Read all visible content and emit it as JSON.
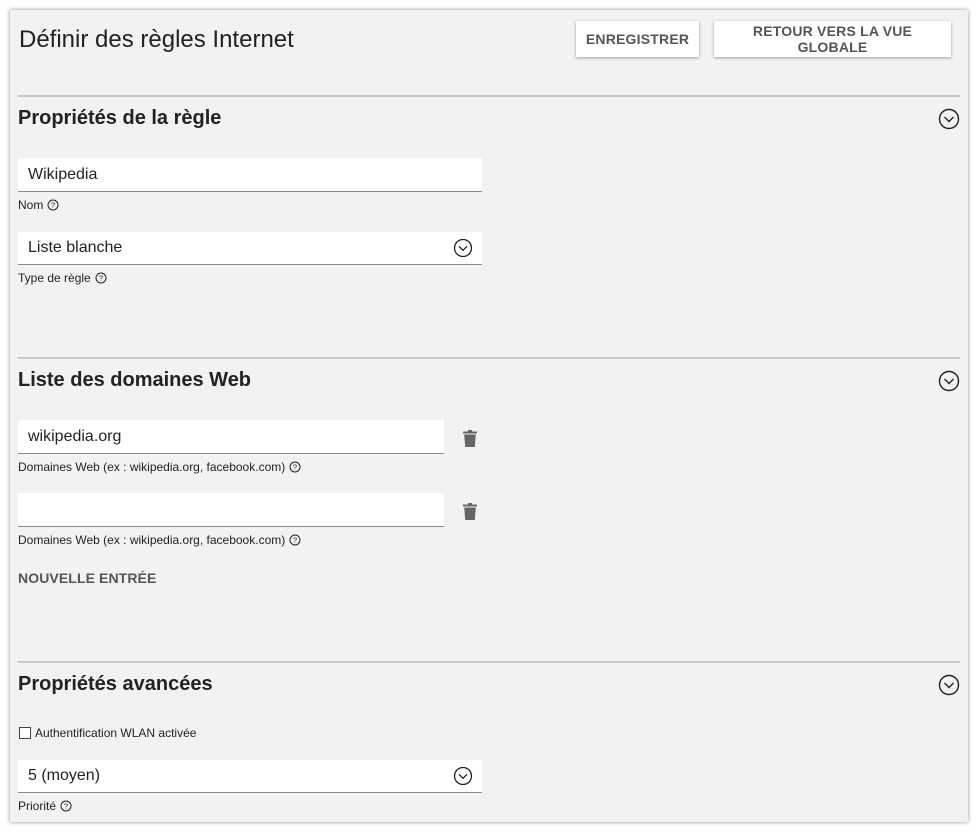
{
  "page": {
    "title": "Définir des règles Internet",
    "save_label": "ENREGISTRER",
    "back_label": "RETOUR VERS LA VUE GLOBALE"
  },
  "rule_properties": {
    "section_title": "Propriétés de la règle",
    "name_value": "Wikipedia",
    "name_label": "Nom",
    "type_value": "Liste blanche",
    "type_label": "Type de règle"
  },
  "domains": {
    "section_title": "Liste des domaines Web",
    "entries": [
      {
        "value": "wikipedia.org",
        "label": "Domaines Web (ex : wikipedia.org, facebook.com)"
      },
      {
        "value": "",
        "label": "Domaines Web (ex : wikipedia.org, facebook.com)"
      }
    ],
    "add_label": "NOUVELLE ENTRÉE"
  },
  "advanced": {
    "section_title": "Propriétés avancées",
    "wlan_auth_label": "Authentification WLAN activée",
    "wlan_auth_checked": false,
    "priority_value": "5 (moyen)",
    "priority_label": "Priorité"
  },
  "icons": {
    "collapse": "chevron-circle-icon",
    "dropdown": "chevron-circle-icon",
    "help": "question-circle-icon",
    "delete": "trash-icon"
  },
  "colors": {
    "panel_bg": "#f2f2f2",
    "divider": "#c8c8c8",
    "button_text": "#555555"
  }
}
